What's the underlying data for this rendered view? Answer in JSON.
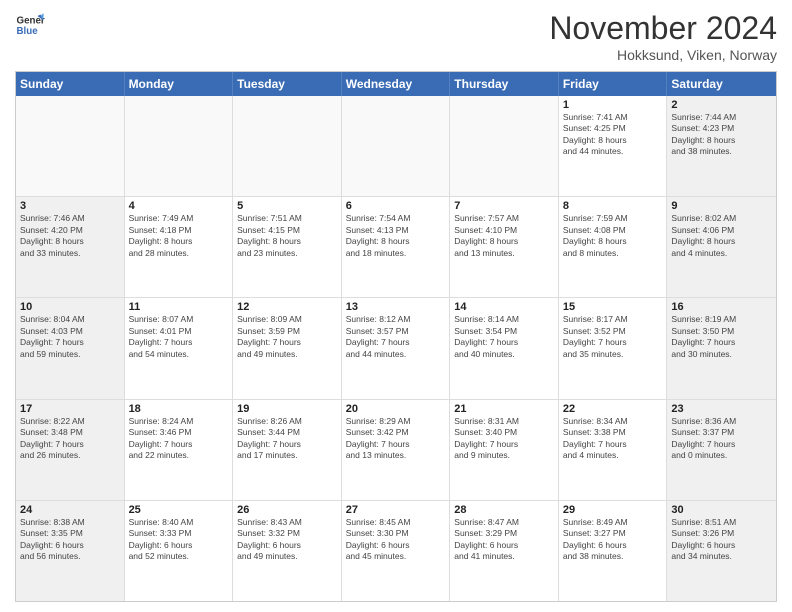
{
  "logo": {
    "line1": "General",
    "line2": "Blue"
  },
  "title": "November 2024",
  "location": "Hokksund, Viken, Norway",
  "header_days": [
    "Sunday",
    "Monday",
    "Tuesday",
    "Wednesday",
    "Thursday",
    "Friday",
    "Saturday"
  ],
  "rows": [
    [
      {
        "day": "",
        "info": ""
      },
      {
        "day": "",
        "info": ""
      },
      {
        "day": "",
        "info": ""
      },
      {
        "day": "",
        "info": ""
      },
      {
        "day": "",
        "info": ""
      },
      {
        "day": "1",
        "info": "Sunrise: 7:41 AM\nSunset: 4:25 PM\nDaylight: 8 hours\nand 44 minutes."
      },
      {
        "day": "2",
        "info": "Sunrise: 7:44 AM\nSunset: 4:23 PM\nDaylight: 8 hours\nand 38 minutes."
      }
    ],
    [
      {
        "day": "3",
        "info": "Sunrise: 7:46 AM\nSunset: 4:20 PM\nDaylight: 8 hours\nand 33 minutes."
      },
      {
        "day": "4",
        "info": "Sunrise: 7:49 AM\nSunset: 4:18 PM\nDaylight: 8 hours\nand 28 minutes."
      },
      {
        "day": "5",
        "info": "Sunrise: 7:51 AM\nSunset: 4:15 PM\nDaylight: 8 hours\nand 23 minutes."
      },
      {
        "day": "6",
        "info": "Sunrise: 7:54 AM\nSunset: 4:13 PM\nDaylight: 8 hours\nand 18 minutes."
      },
      {
        "day": "7",
        "info": "Sunrise: 7:57 AM\nSunset: 4:10 PM\nDaylight: 8 hours\nand 13 minutes."
      },
      {
        "day": "8",
        "info": "Sunrise: 7:59 AM\nSunset: 4:08 PM\nDaylight: 8 hours\nand 8 minutes."
      },
      {
        "day": "9",
        "info": "Sunrise: 8:02 AM\nSunset: 4:06 PM\nDaylight: 8 hours\nand 4 minutes."
      }
    ],
    [
      {
        "day": "10",
        "info": "Sunrise: 8:04 AM\nSunset: 4:03 PM\nDaylight: 7 hours\nand 59 minutes."
      },
      {
        "day": "11",
        "info": "Sunrise: 8:07 AM\nSunset: 4:01 PM\nDaylight: 7 hours\nand 54 minutes."
      },
      {
        "day": "12",
        "info": "Sunrise: 8:09 AM\nSunset: 3:59 PM\nDaylight: 7 hours\nand 49 minutes."
      },
      {
        "day": "13",
        "info": "Sunrise: 8:12 AM\nSunset: 3:57 PM\nDaylight: 7 hours\nand 44 minutes."
      },
      {
        "day": "14",
        "info": "Sunrise: 8:14 AM\nSunset: 3:54 PM\nDaylight: 7 hours\nand 40 minutes."
      },
      {
        "day": "15",
        "info": "Sunrise: 8:17 AM\nSunset: 3:52 PM\nDaylight: 7 hours\nand 35 minutes."
      },
      {
        "day": "16",
        "info": "Sunrise: 8:19 AM\nSunset: 3:50 PM\nDaylight: 7 hours\nand 30 minutes."
      }
    ],
    [
      {
        "day": "17",
        "info": "Sunrise: 8:22 AM\nSunset: 3:48 PM\nDaylight: 7 hours\nand 26 minutes."
      },
      {
        "day": "18",
        "info": "Sunrise: 8:24 AM\nSunset: 3:46 PM\nDaylight: 7 hours\nand 22 minutes."
      },
      {
        "day": "19",
        "info": "Sunrise: 8:26 AM\nSunset: 3:44 PM\nDaylight: 7 hours\nand 17 minutes."
      },
      {
        "day": "20",
        "info": "Sunrise: 8:29 AM\nSunset: 3:42 PM\nDaylight: 7 hours\nand 13 minutes."
      },
      {
        "day": "21",
        "info": "Sunrise: 8:31 AM\nSunset: 3:40 PM\nDaylight: 7 hours\nand 9 minutes."
      },
      {
        "day": "22",
        "info": "Sunrise: 8:34 AM\nSunset: 3:38 PM\nDaylight: 7 hours\nand 4 minutes."
      },
      {
        "day": "23",
        "info": "Sunrise: 8:36 AM\nSunset: 3:37 PM\nDaylight: 7 hours\nand 0 minutes."
      }
    ],
    [
      {
        "day": "24",
        "info": "Sunrise: 8:38 AM\nSunset: 3:35 PM\nDaylight: 6 hours\nand 56 minutes."
      },
      {
        "day": "25",
        "info": "Sunrise: 8:40 AM\nSunset: 3:33 PM\nDaylight: 6 hours\nand 52 minutes."
      },
      {
        "day": "26",
        "info": "Sunrise: 8:43 AM\nSunset: 3:32 PM\nDaylight: 6 hours\nand 49 minutes."
      },
      {
        "day": "27",
        "info": "Sunrise: 8:45 AM\nSunset: 3:30 PM\nDaylight: 6 hours\nand 45 minutes."
      },
      {
        "day": "28",
        "info": "Sunrise: 8:47 AM\nSunset: 3:29 PM\nDaylight: 6 hours\nand 41 minutes."
      },
      {
        "day": "29",
        "info": "Sunrise: 8:49 AM\nSunset: 3:27 PM\nDaylight: 6 hours\nand 38 minutes."
      },
      {
        "day": "30",
        "info": "Sunrise: 8:51 AM\nSunset: 3:26 PM\nDaylight: 6 hours\nand 34 minutes."
      }
    ]
  ]
}
